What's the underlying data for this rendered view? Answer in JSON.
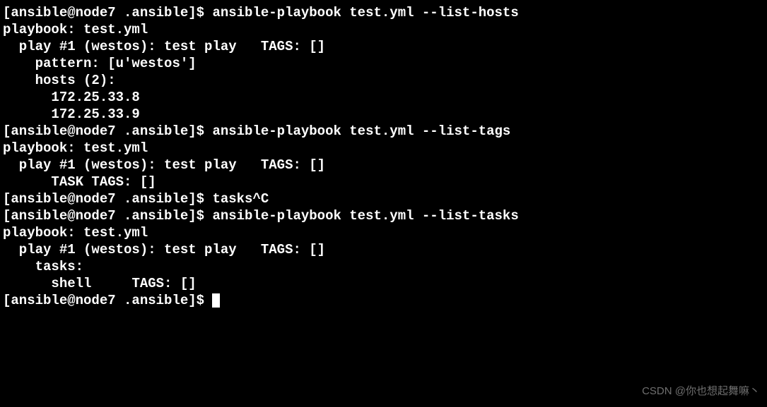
{
  "prompt": "[ansible@node7 .ansible]$ ",
  "commands": {
    "list_hosts": "ansible-playbook test.yml --list-hosts",
    "list_tags": "ansible-playbook test.yml --list-tags",
    "tasks_cancelled": "tasks^C",
    "list_tasks": "ansible-playbook test.yml --list-tasks"
  },
  "output": {
    "blank": "",
    "playbook_header": "playbook: test.yml",
    "play_line": "  play #1 (westos): test play\tTAGS: []",
    "hosts_section": {
      "pattern": "    pattern: [u'westos']",
      "hosts_count": "    hosts (2):",
      "host1": "      172.25.33.8",
      "host2": "      172.25.33.9"
    },
    "tags_section": {
      "task_tags": "      TASK TAGS: []"
    },
    "tasks_section": {
      "tasks_label": "    tasks:",
      "shell_task": "      shell\tTAGS: []"
    }
  },
  "watermark": "CSDN @你也想起舞嘛丶"
}
